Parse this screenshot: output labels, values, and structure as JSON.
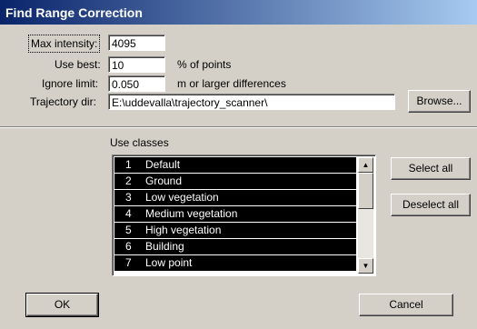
{
  "window": {
    "title": "Find Range Correction"
  },
  "fields": {
    "max_intensity": {
      "label": "Max intensity:",
      "value": "4095"
    },
    "use_best": {
      "label": "Use best:",
      "value": "10",
      "unit": "% of points"
    },
    "ignore_limit": {
      "label": "Ignore limit:",
      "value": "0.050",
      "unit": "m    or larger differences"
    },
    "trajectory_dir": {
      "label": "Trajectory dir:",
      "value": "E:\\uddevalla\\trajectory_scanner\\"
    }
  },
  "buttons": {
    "browse": "Browse...",
    "select_all": "Select all",
    "deselect_all": "Deselect all",
    "ok": "OK",
    "cancel": "Cancel"
  },
  "classes": {
    "label": "Use classes",
    "items": [
      {
        "num": "1",
        "name": "Default",
        "selected": true
      },
      {
        "num": "2",
        "name": "Ground",
        "selected": true
      },
      {
        "num": "3",
        "name": "Low vegetation",
        "selected": true
      },
      {
        "num": "4",
        "name": "Medium vegetation",
        "selected": true
      },
      {
        "num": "5",
        "name": "High vegetation",
        "selected": true
      },
      {
        "num": "6",
        "name": "Building",
        "selected": true
      },
      {
        "num": "7",
        "name": "Low point",
        "selected": true
      }
    ]
  },
  "icons": {
    "scroll_up": "scroll-up-arrow-icon",
    "scroll_down": "scroll-down-arrow-icon"
  },
  "colors": {
    "titlebar_start": "#0a246a",
    "titlebar_end": "#a6caf0",
    "face": "#d4d0c8",
    "selection": "#000000"
  }
}
